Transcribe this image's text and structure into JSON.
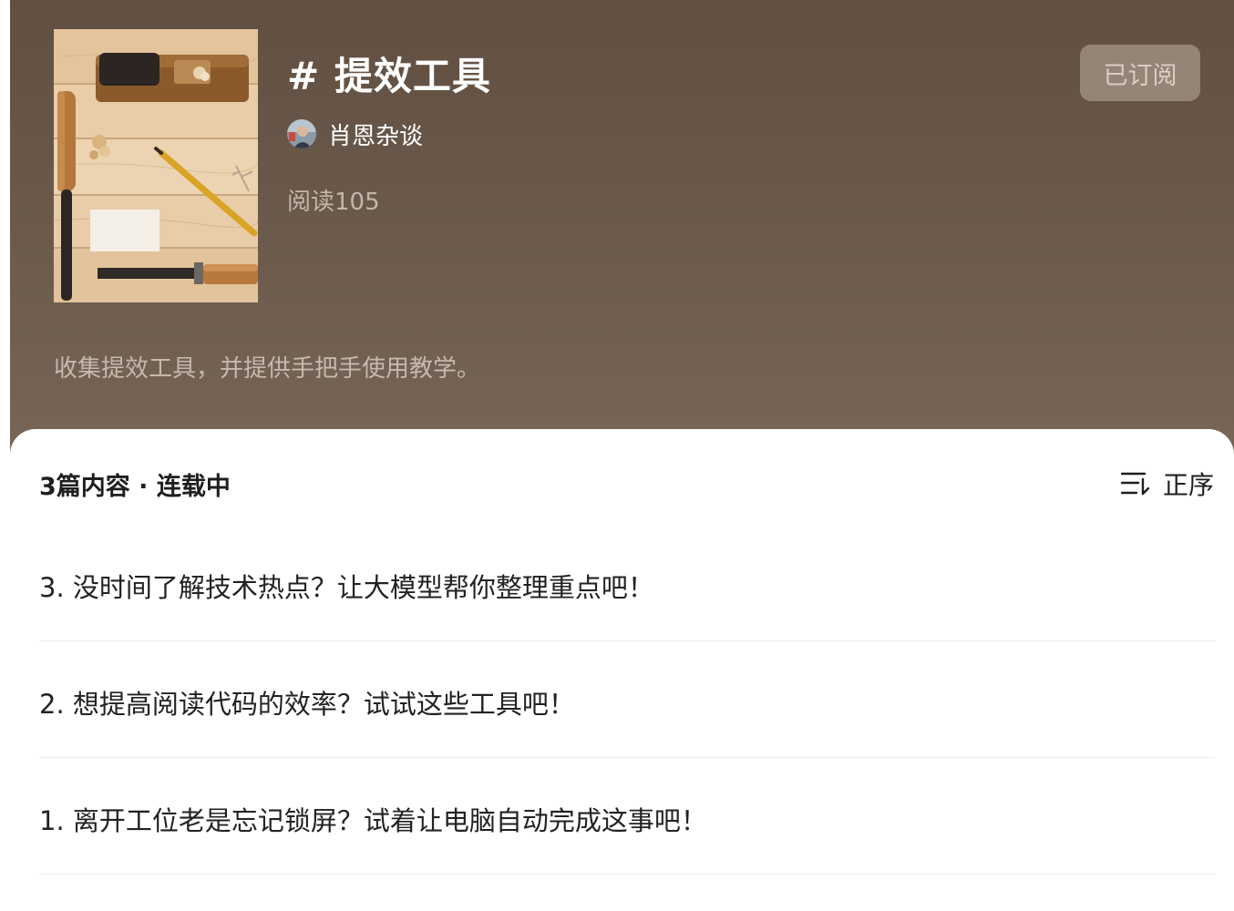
{
  "column": {
    "title": "# 提效工具",
    "author": "肖恩杂谈",
    "reads": "阅读105",
    "subscribe_label": "已订阅",
    "description": "收集提效工具，并提供手把手使用教学。"
  },
  "list_header": {
    "count_status": "3篇内容 · 连载中",
    "sort_label": "正序",
    "sort_icon": "sort-order-icon"
  },
  "articles": [
    {
      "title": "3. 没时间了解技术热点？让大模型帮你整理重点吧！"
    },
    {
      "title": "2. 想提高阅读代码的效率？试试这些工具吧！"
    },
    {
      "title": "1. 离开工位老是忘记锁屏？试着让电脑自动完成这事吧！"
    }
  ],
  "colors": {
    "header_top": "#614f41",
    "header_bottom": "#776657",
    "button_bg": "#958576",
    "divider": "#ececec"
  }
}
